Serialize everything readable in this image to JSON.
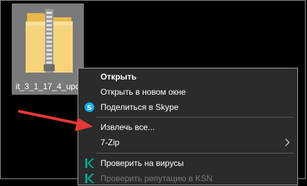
{
  "desktop": {
    "file": {
      "label": "it_3_1_17_4_upd",
      "icon": "zip-folder-icon"
    }
  },
  "context_menu": {
    "items": [
      {
        "label": "Открыть"
      },
      {
        "label": "Открыть в новом окне"
      },
      {
        "label": "Поделиться в Skype",
        "icon": "skype-icon"
      },
      {
        "label": "Извлечь все..."
      },
      {
        "label": "7-Zip",
        "icon": "chevron-right-icon"
      },
      {
        "label": "Проверить на вирусы",
        "icon": "kaspersky-icon"
      },
      {
        "label": "Проверить репутацию в KSN",
        "icon": "kaspersky-icon"
      }
    ]
  },
  "colors": {
    "background": "#000000",
    "selected_item": "#7a7a7a",
    "menu_background": "#2b2b2b",
    "annotation_arrow": "#e53935",
    "skype_blue": "#00aff0",
    "kaspersky_green": "#00a88e"
  }
}
